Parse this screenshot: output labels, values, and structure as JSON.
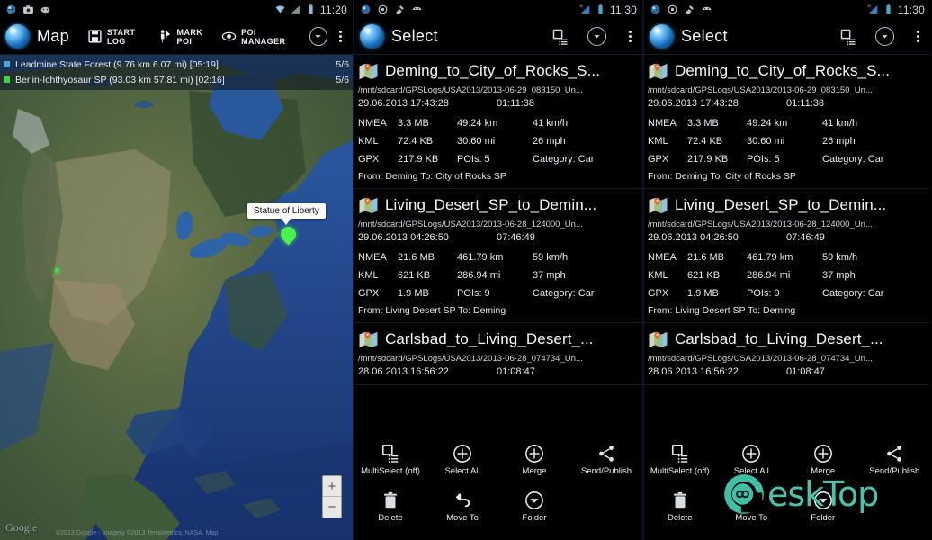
{
  "panel_map": {
    "status_bar": {
      "time": "11:20",
      "left_icons": [
        "app-globe-icon",
        "camera-icon",
        "sync-icon"
      ],
      "right_icons": [
        "wifi-icon",
        "signal-icon",
        "battery-icon"
      ]
    },
    "action_bar": {
      "title": "Map",
      "buttons": [
        {
          "label": "START LOG",
          "icon": "save-log-icon"
        },
        {
          "label": "MARK POI",
          "icon": "mark-poi-icon"
        },
        {
          "label": "POI MANAGER",
          "icon": "eye-poi-icon"
        }
      ],
      "overflow_icon": "more-vertical-icon",
      "dropdown_icon": "chevron-down-circle-icon"
    },
    "overlay_tracks": [
      {
        "color": "#4aa7d8",
        "label": "Leadmine State Forest (9.76 km 6.07 mi) [05:19]",
        "count": "5/6"
      },
      {
        "color": "#3fd14a",
        "label": "Berlin-Ichthyosaur SP (93.03 km 57.81 mi) [02:16]",
        "count": "5/6"
      }
    ],
    "marker": {
      "label": "Statue of Liberty"
    },
    "zoom_controls": {
      "in": "+",
      "out": "−"
    },
    "attribution": {
      "logo": "Google",
      "credit": "©2013 Google - Imagery ©2013 TerraMetrics, NASA, Map"
    }
  },
  "panel_select": {
    "status_bar": {
      "time": "11:30",
      "left_icons": [
        "app-globe-icon",
        "gps-target-icon",
        "satellite-icon",
        "android-icon"
      ],
      "right_icons": [
        "hsignal-icon",
        "battery-icon"
      ]
    },
    "action_bar": {
      "title": "Select",
      "multiselect_icon": "multiselect-icon",
      "dropdown_icon": "chevron-down-circle-icon",
      "overflow_icon": "more-vertical-icon"
    },
    "items": [
      {
        "title": "Deming_to_City_of_Rocks_S...",
        "path": "/mnt/sdcard/GPSLogs/USA2013/2013-06-29_083150_Un...",
        "datetime": "29.06.2013 17:43:28",
        "duration": "01:11:38",
        "rows": [
          {
            "format": "NMEA",
            "size": "3.3 MB",
            "metric": "49.24 km",
            "speed": "41 km/h"
          },
          {
            "format": "KML",
            "size": "72.4 KB",
            "metric": "30.60 mi",
            "speed": "26 mph"
          },
          {
            "format": "GPX",
            "size": "217.9 KB",
            "metric": "POIs: 5",
            "speed": "Category: Car"
          }
        ],
        "from_to": "From: Deming To: City of Rocks SP"
      },
      {
        "title": "Living_Desert_SP_to_Demin...",
        "path": "/mnt/sdcard/GPSLogs/USA2013/2013-06-28_124000_Un...",
        "datetime": "29.06.2013 04:26:50",
        "duration": "07:46:49",
        "rows": [
          {
            "format": "NMEA",
            "size": "21.6 MB",
            "metric": "461.79 km",
            "speed": "59 km/h"
          },
          {
            "format": "KML",
            "size": "621 KB",
            "metric": "286.94 mi",
            "speed": "37 mph"
          },
          {
            "format": "GPX",
            "size": "1.9 MB",
            "metric": "POIs: 9",
            "speed": "Category: Car"
          }
        ],
        "from_to": "From: Living Desert SP To: Deming"
      },
      {
        "title": "Carlsbad_to_Living_Desert_...",
        "path": "/mnt/sdcard/GPSLogs/USA2013/2013-06-28_074734_Un...",
        "datetime": "28.06.2013 16:56:22",
        "duration": "01:08:47",
        "rows": [],
        "from_to": ""
      }
    ],
    "bottom_actions": [
      {
        "label": "MultiSelect (off)",
        "icon": "multiselect-icon"
      },
      {
        "label": "Select All",
        "icon": "plus-circle-icon"
      },
      {
        "label": "Merge",
        "icon": "plus-circle-icon"
      },
      {
        "label": "Send/Publish",
        "icon": "share-icon"
      },
      {
        "label": "Delete",
        "icon": "trash-icon"
      },
      {
        "label": "Move To",
        "icon": "move-to-arrow-icon"
      },
      {
        "label": "Folder",
        "icon": "chevron-down-circle-icon"
      }
    ]
  },
  "watermark": {
    "text": "eskTop",
    "color": "#49c5ae"
  }
}
